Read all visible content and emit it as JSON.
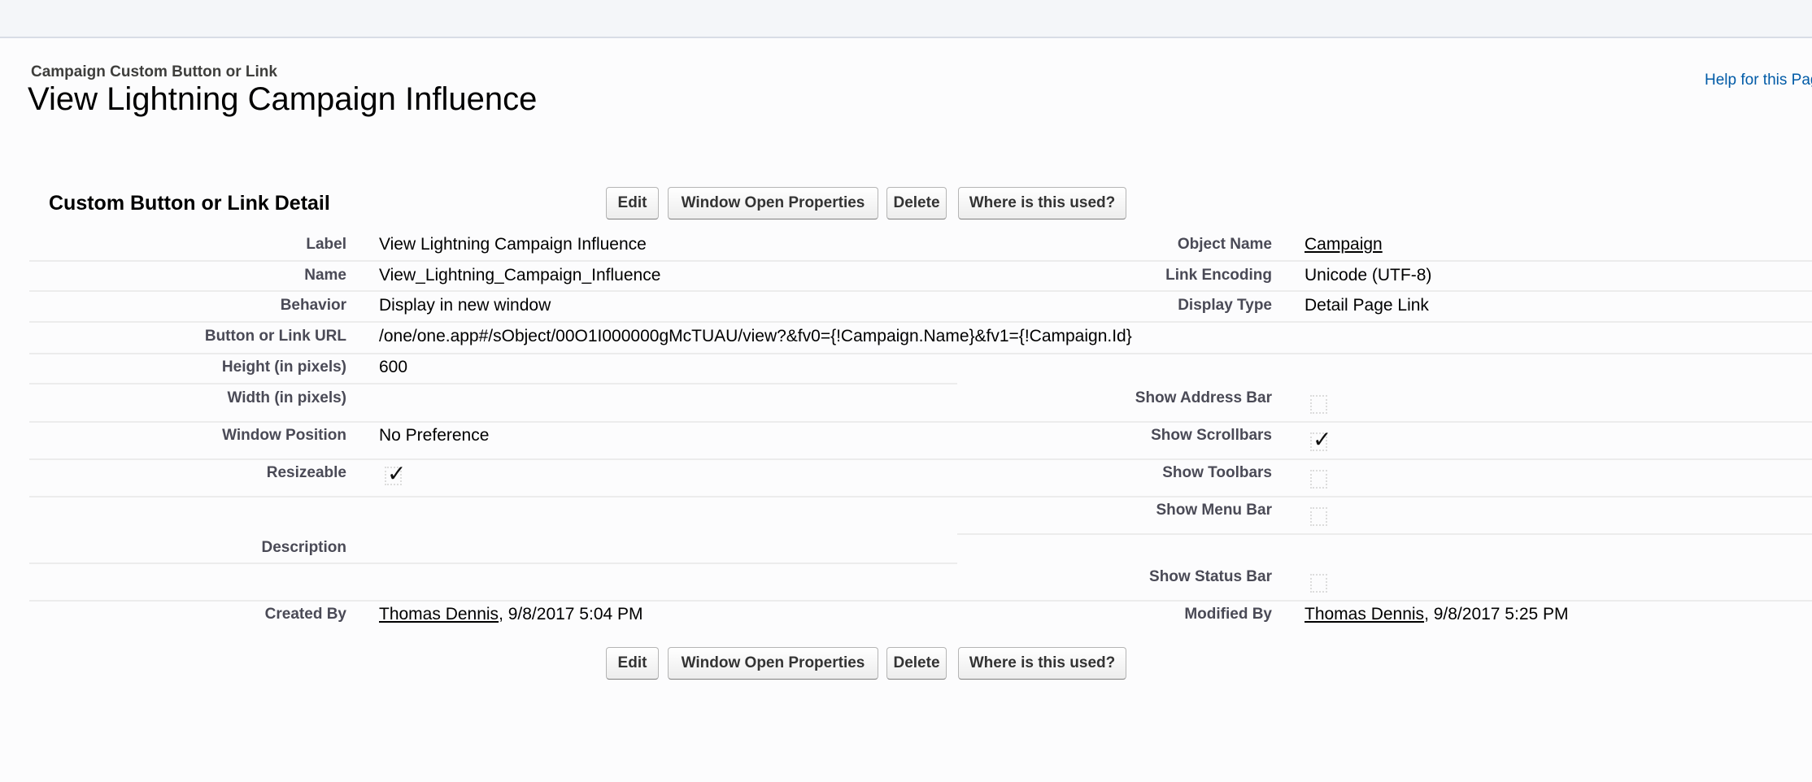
{
  "header": {
    "subtitle": "Campaign Custom Button or Link",
    "title": "View Lightning Campaign Influence",
    "help_link": "Help for this Page"
  },
  "section": {
    "title": "Custom Button or Link Detail"
  },
  "buttons": {
    "edit": "Edit",
    "window_open_properties": "Window Open Properties",
    "delete": "Delete",
    "where_used": "Where is this used?"
  },
  "fields": {
    "label": {
      "label": "Label",
      "value": "View Lightning Campaign Influence"
    },
    "name": {
      "label": "Name",
      "value": "View_Lightning_Campaign_Influence"
    },
    "behavior": {
      "label": "Behavior",
      "value": "Display in new window"
    },
    "url": {
      "label": "Button or Link URL",
      "value": "/one/one.app#/sObject/00O1I000000gMcTUAU/view?&fv0={!Campaign.Name}&fv1={!Campaign.Id}"
    },
    "height": {
      "label": "Height (in pixels)",
      "value": "600"
    },
    "width": {
      "label": "Width (in pixels)",
      "value": ""
    },
    "window_position": {
      "label": "Window Position",
      "value": "No Preference"
    },
    "resizeable": {
      "label": "Resizeable",
      "checked": true
    },
    "description": {
      "label": "Description",
      "value": ""
    },
    "created_by": {
      "label": "Created By",
      "user": "Thomas Dennis",
      "date": ", 9/8/2017 5:04 PM"
    },
    "object_name": {
      "label": "Object Name",
      "value": "Campaign"
    },
    "link_encoding": {
      "label": "Link Encoding",
      "value": "Unicode (UTF-8)"
    },
    "display_type": {
      "label": "Display Type",
      "value": "Detail Page Link"
    },
    "show_address_bar": {
      "label": "Show Address Bar",
      "checked": false
    },
    "show_scrollbars": {
      "label": "Show Scrollbars",
      "checked": true
    },
    "show_toolbars": {
      "label": "Show Toolbars",
      "checked": false
    },
    "show_menu_bar": {
      "label": "Show Menu Bar",
      "checked": false
    },
    "show_status_bar": {
      "label": "Show Status Bar",
      "checked": false
    },
    "modified_by": {
      "label": "Modified By",
      "user": "Thomas Dennis",
      "date": ", 9/8/2017 5:25 PM"
    }
  },
  "checkmark": "✓"
}
